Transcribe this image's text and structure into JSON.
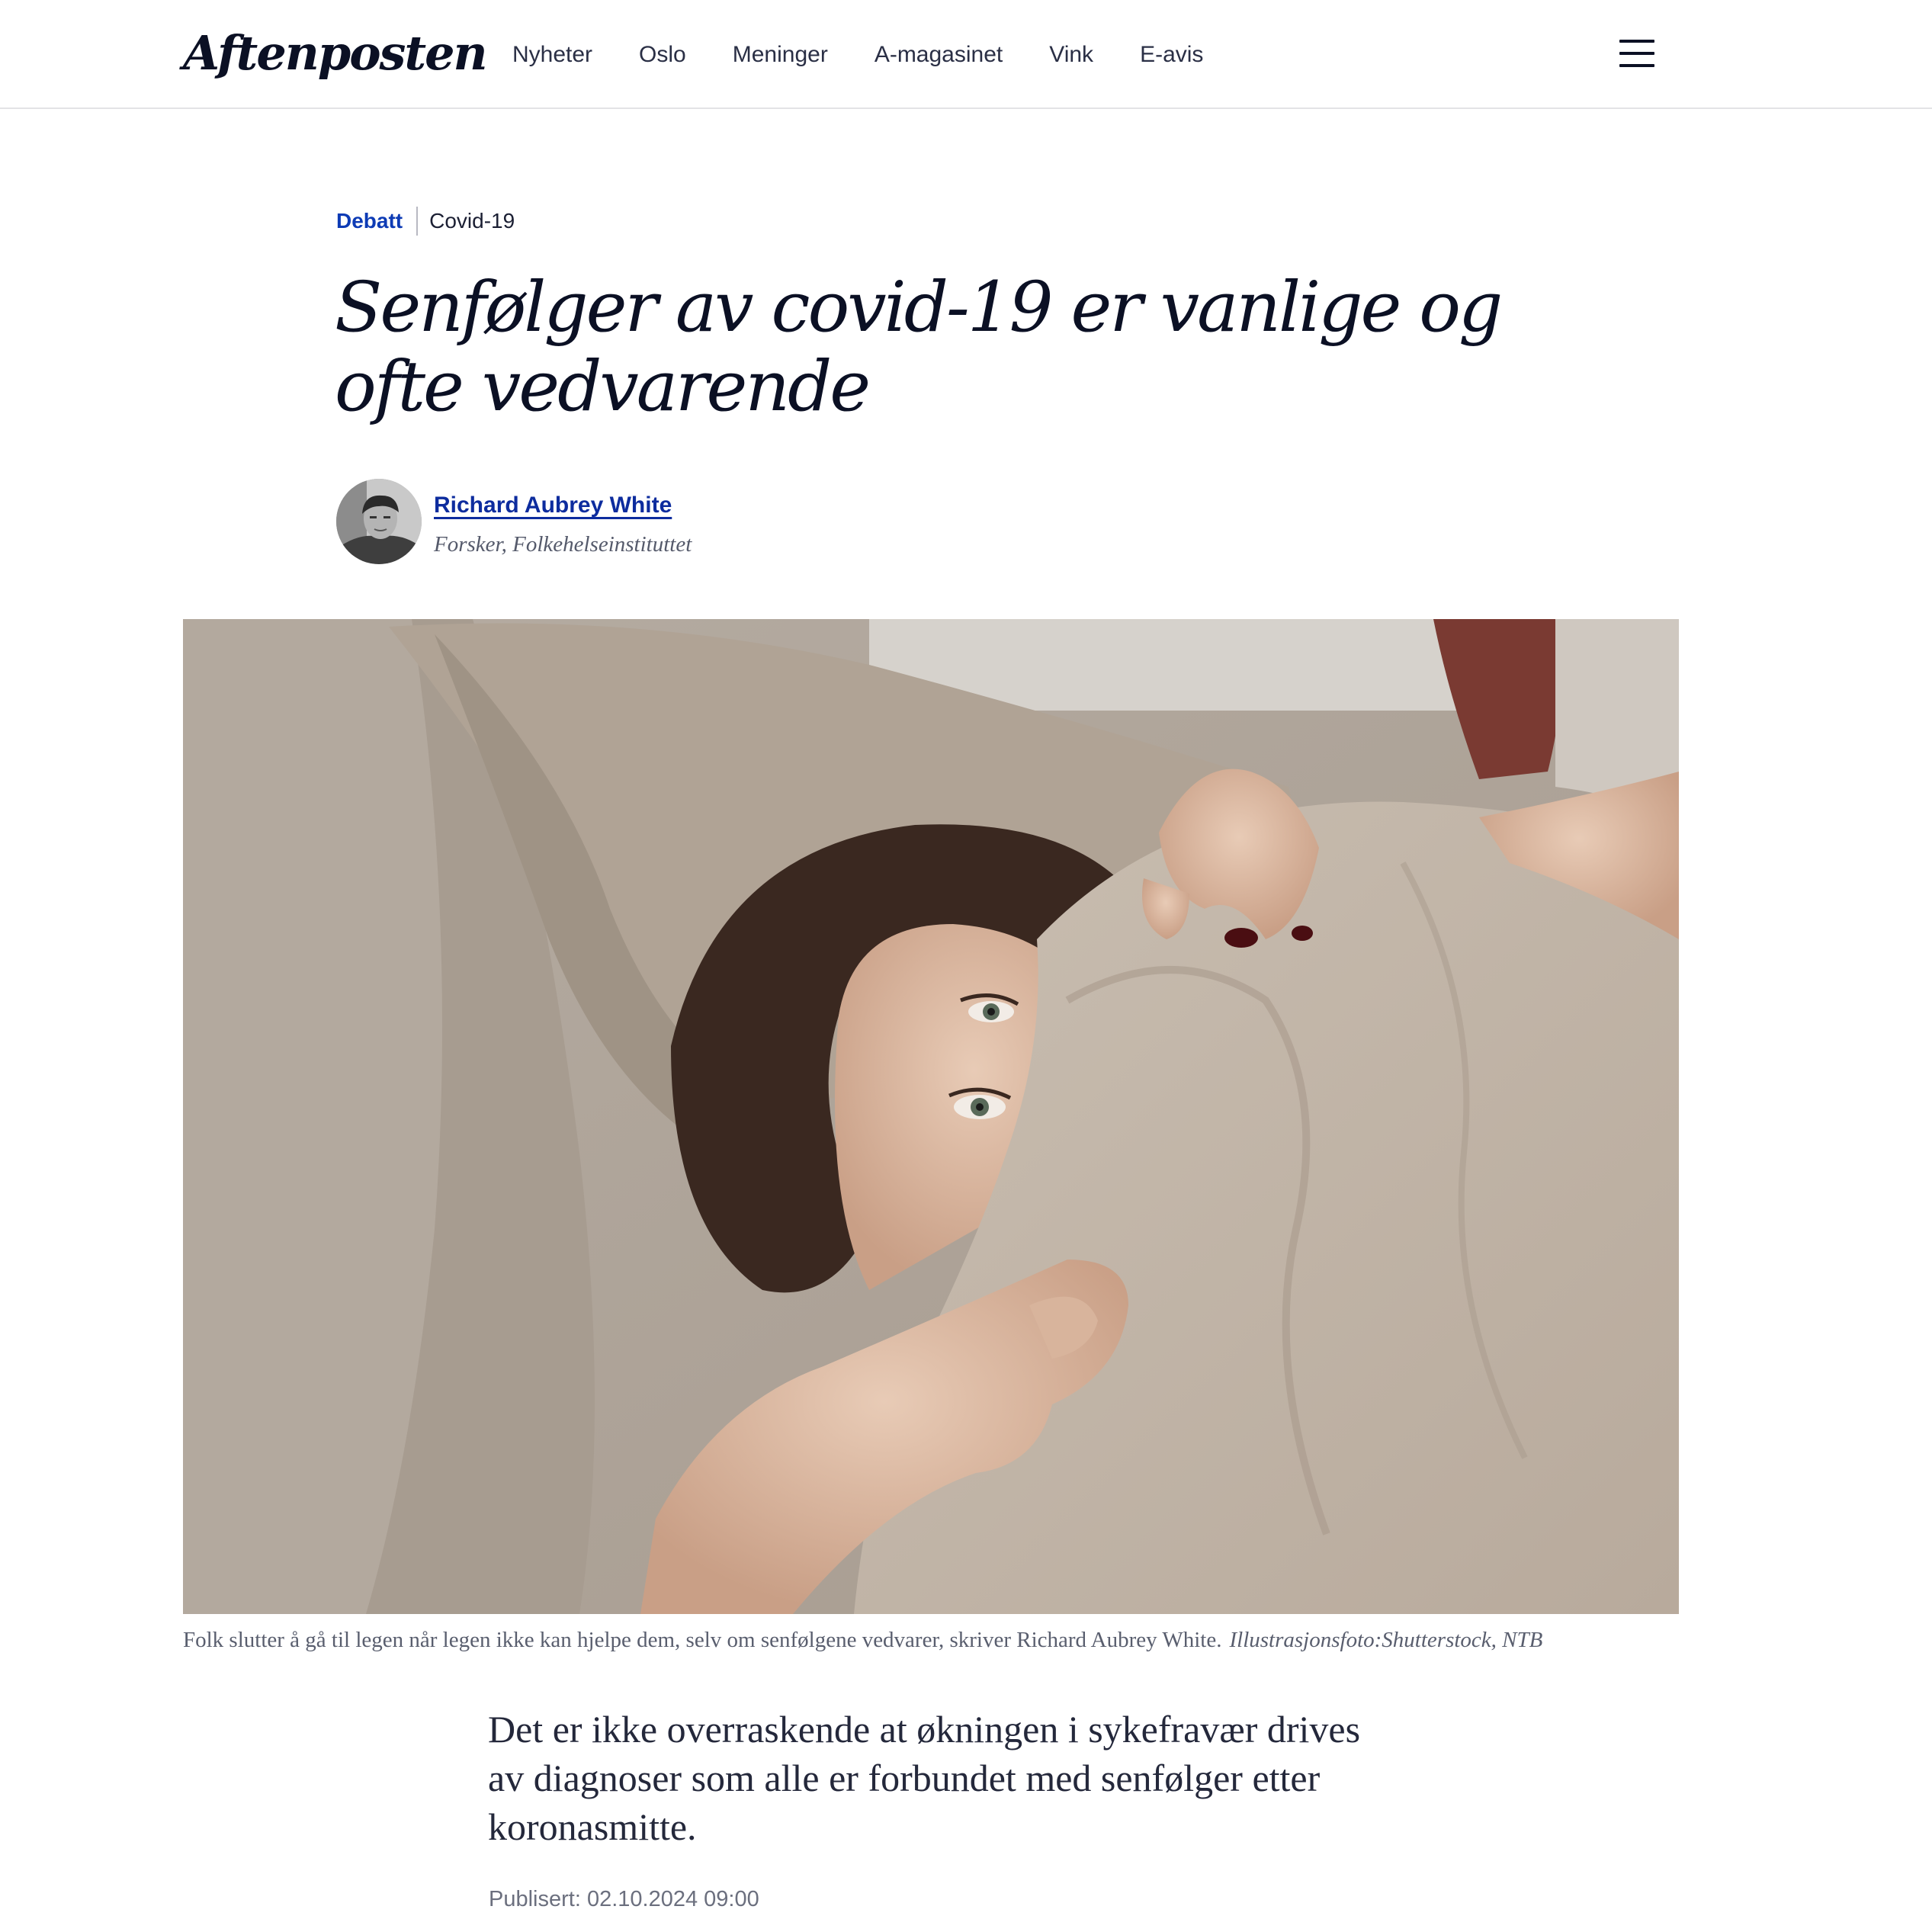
{
  "header": {
    "logo": "Aftenposten",
    "nav": [
      "Nyheter",
      "Oslo",
      "Meninger",
      "A-magasinet",
      "Vink",
      "E-avis"
    ]
  },
  "article": {
    "section": "Debatt",
    "topic": "Covid-19",
    "headline": "Senfølger av covid-19 er vanlige og ofte vedvarende",
    "author": {
      "name": "Richard Aubrey White",
      "role": "Forsker, Folkehelseinstituttet"
    },
    "image": {
      "caption": "Folk slutter å gå til legen når legen ikke kan hjelpe dem, selv om senfølgene vedvarer, skriver Richard Aubrey White.",
      "credit": "Illustrasjonsfoto:Shutterstock, NTB"
    },
    "lead": "Det er ikke overraskende at økningen i sykefravær drives av diagnoser som alle er forbundet med senfølger etter koronasmitte.",
    "published": "Publisert: 02.10.2024 09:00"
  },
  "colors": {
    "brand_text": "#0b1024",
    "link_blue": "#0d2c9e",
    "section_blue": "#0d3bb5"
  }
}
